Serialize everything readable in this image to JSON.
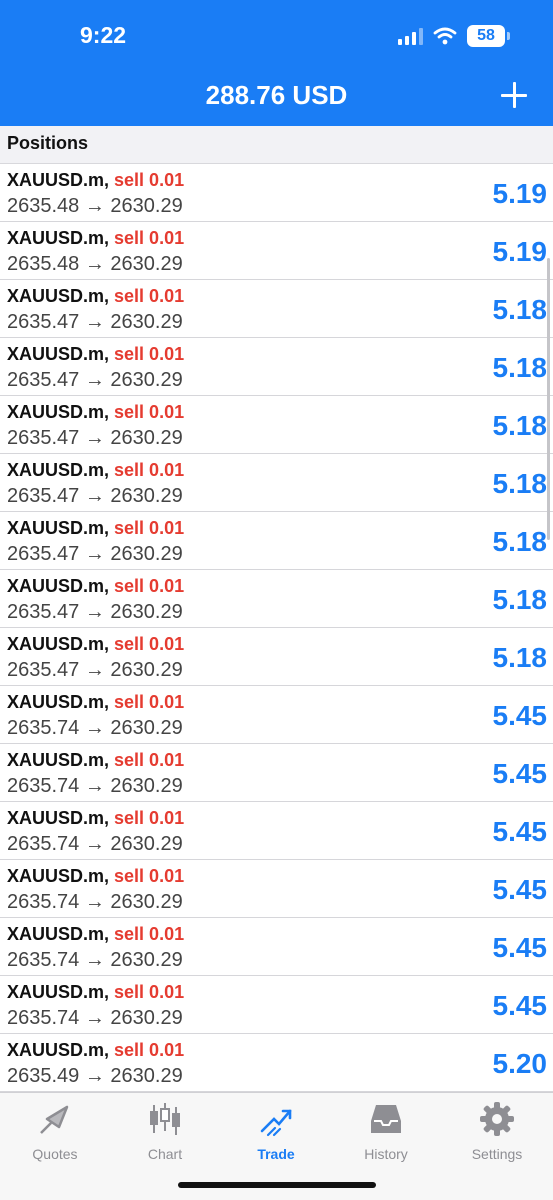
{
  "status_bar": {
    "time": "9:22",
    "battery": "58"
  },
  "header": {
    "title": "288.76 USD",
    "add_icon": "plus-icon"
  },
  "section": {
    "title": "Positions"
  },
  "positions": [
    {
      "symbol": "XAUUSD.m,",
      "direction": "sell 0.01",
      "open_price": "2635.48",
      "arrow": "→",
      "current_price": "2630.29",
      "profit": "5.19"
    },
    {
      "symbol": "XAUUSD.m,",
      "direction": "sell 0.01",
      "open_price": "2635.48",
      "arrow": "→",
      "current_price": "2630.29",
      "profit": "5.19"
    },
    {
      "symbol": "XAUUSD.m,",
      "direction": "sell 0.01",
      "open_price": "2635.47",
      "arrow": "→",
      "current_price": "2630.29",
      "profit": "5.18"
    },
    {
      "symbol": "XAUUSD.m,",
      "direction": "sell 0.01",
      "open_price": "2635.47",
      "arrow": "→",
      "current_price": "2630.29",
      "profit": "5.18"
    },
    {
      "symbol": "XAUUSD.m,",
      "direction": "sell 0.01",
      "open_price": "2635.47",
      "arrow": "→",
      "current_price": "2630.29",
      "profit": "5.18"
    },
    {
      "symbol": "XAUUSD.m,",
      "direction": "sell 0.01",
      "open_price": "2635.47",
      "arrow": "→",
      "current_price": "2630.29",
      "profit": "5.18"
    },
    {
      "symbol": "XAUUSD.m,",
      "direction": "sell 0.01",
      "open_price": "2635.47",
      "arrow": "→",
      "current_price": "2630.29",
      "profit": "5.18"
    },
    {
      "symbol": "XAUUSD.m,",
      "direction": "sell 0.01",
      "open_price": "2635.47",
      "arrow": "→",
      "current_price": "2630.29",
      "profit": "5.18"
    },
    {
      "symbol": "XAUUSD.m,",
      "direction": "sell 0.01",
      "open_price": "2635.47",
      "arrow": "→",
      "current_price": "2630.29",
      "profit": "5.18"
    },
    {
      "symbol": "XAUUSD.m,",
      "direction": "sell 0.01",
      "open_price": "2635.74",
      "arrow": "→",
      "current_price": "2630.29",
      "profit": "5.45"
    },
    {
      "symbol": "XAUUSD.m,",
      "direction": "sell 0.01",
      "open_price": "2635.74",
      "arrow": "→",
      "current_price": "2630.29",
      "profit": "5.45"
    },
    {
      "symbol": "XAUUSD.m,",
      "direction": "sell 0.01",
      "open_price": "2635.74",
      "arrow": "→",
      "current_price": "2630.29",
      "profit": "5.45"
    },
    {
      "symbol": "XAUUSD.m,",
      "direction": "sell 0.01",
      "open_price": "2635.74",
      "arrow": "→",
      "current_price": "2630.29",
      "profit": "5.45"
    },
    {
      "symbol": "XAUUSD.m,",
      "direction": "sell 0.01",
      "open_price": "2635.74",
      "arrow": "→",
      "current_price": "2630.29",
      "profit": "5.45"
    },
    {
      "symbol": "XAUUSD.m,",
      "direction": "sell 0.01",
      "open_price": "2635.74",
      "arrow": "→",
      "current_price": "2630.29",
      "profit": "5.45"
    },
    {
      "symbol": "XAUUSD.m,",
      "direction": "sell 0.01",
      "open_price": "2635.49",
      "arrow": "→",
      "current_price": "2630.29",
      "profit": "5.20"
    }
  ],
  "tabs": [
    {
      "label": "Quotes",
      "icon": "quotes-icon",
      "active": false
    },
    {
      "label": "Chart",
      "icon": "candlestick-chart-icon",
      "active": false
    },
    {
      "label": "Trade",
      "icon": "trade-icon",
      "active": true
    },
    {
      "label": "History",
      "icon": "inbox-history-icon",
      "active": false
    },
    {
      "label": "Settings",
      "icon": "gear-icon",
      "active": false
    }
  ],
  "colors": {
    "accent": "#1a7df5",
    "sell": "#e53b30",
    "inactive_tab": "#8e8e93"
  }
}
